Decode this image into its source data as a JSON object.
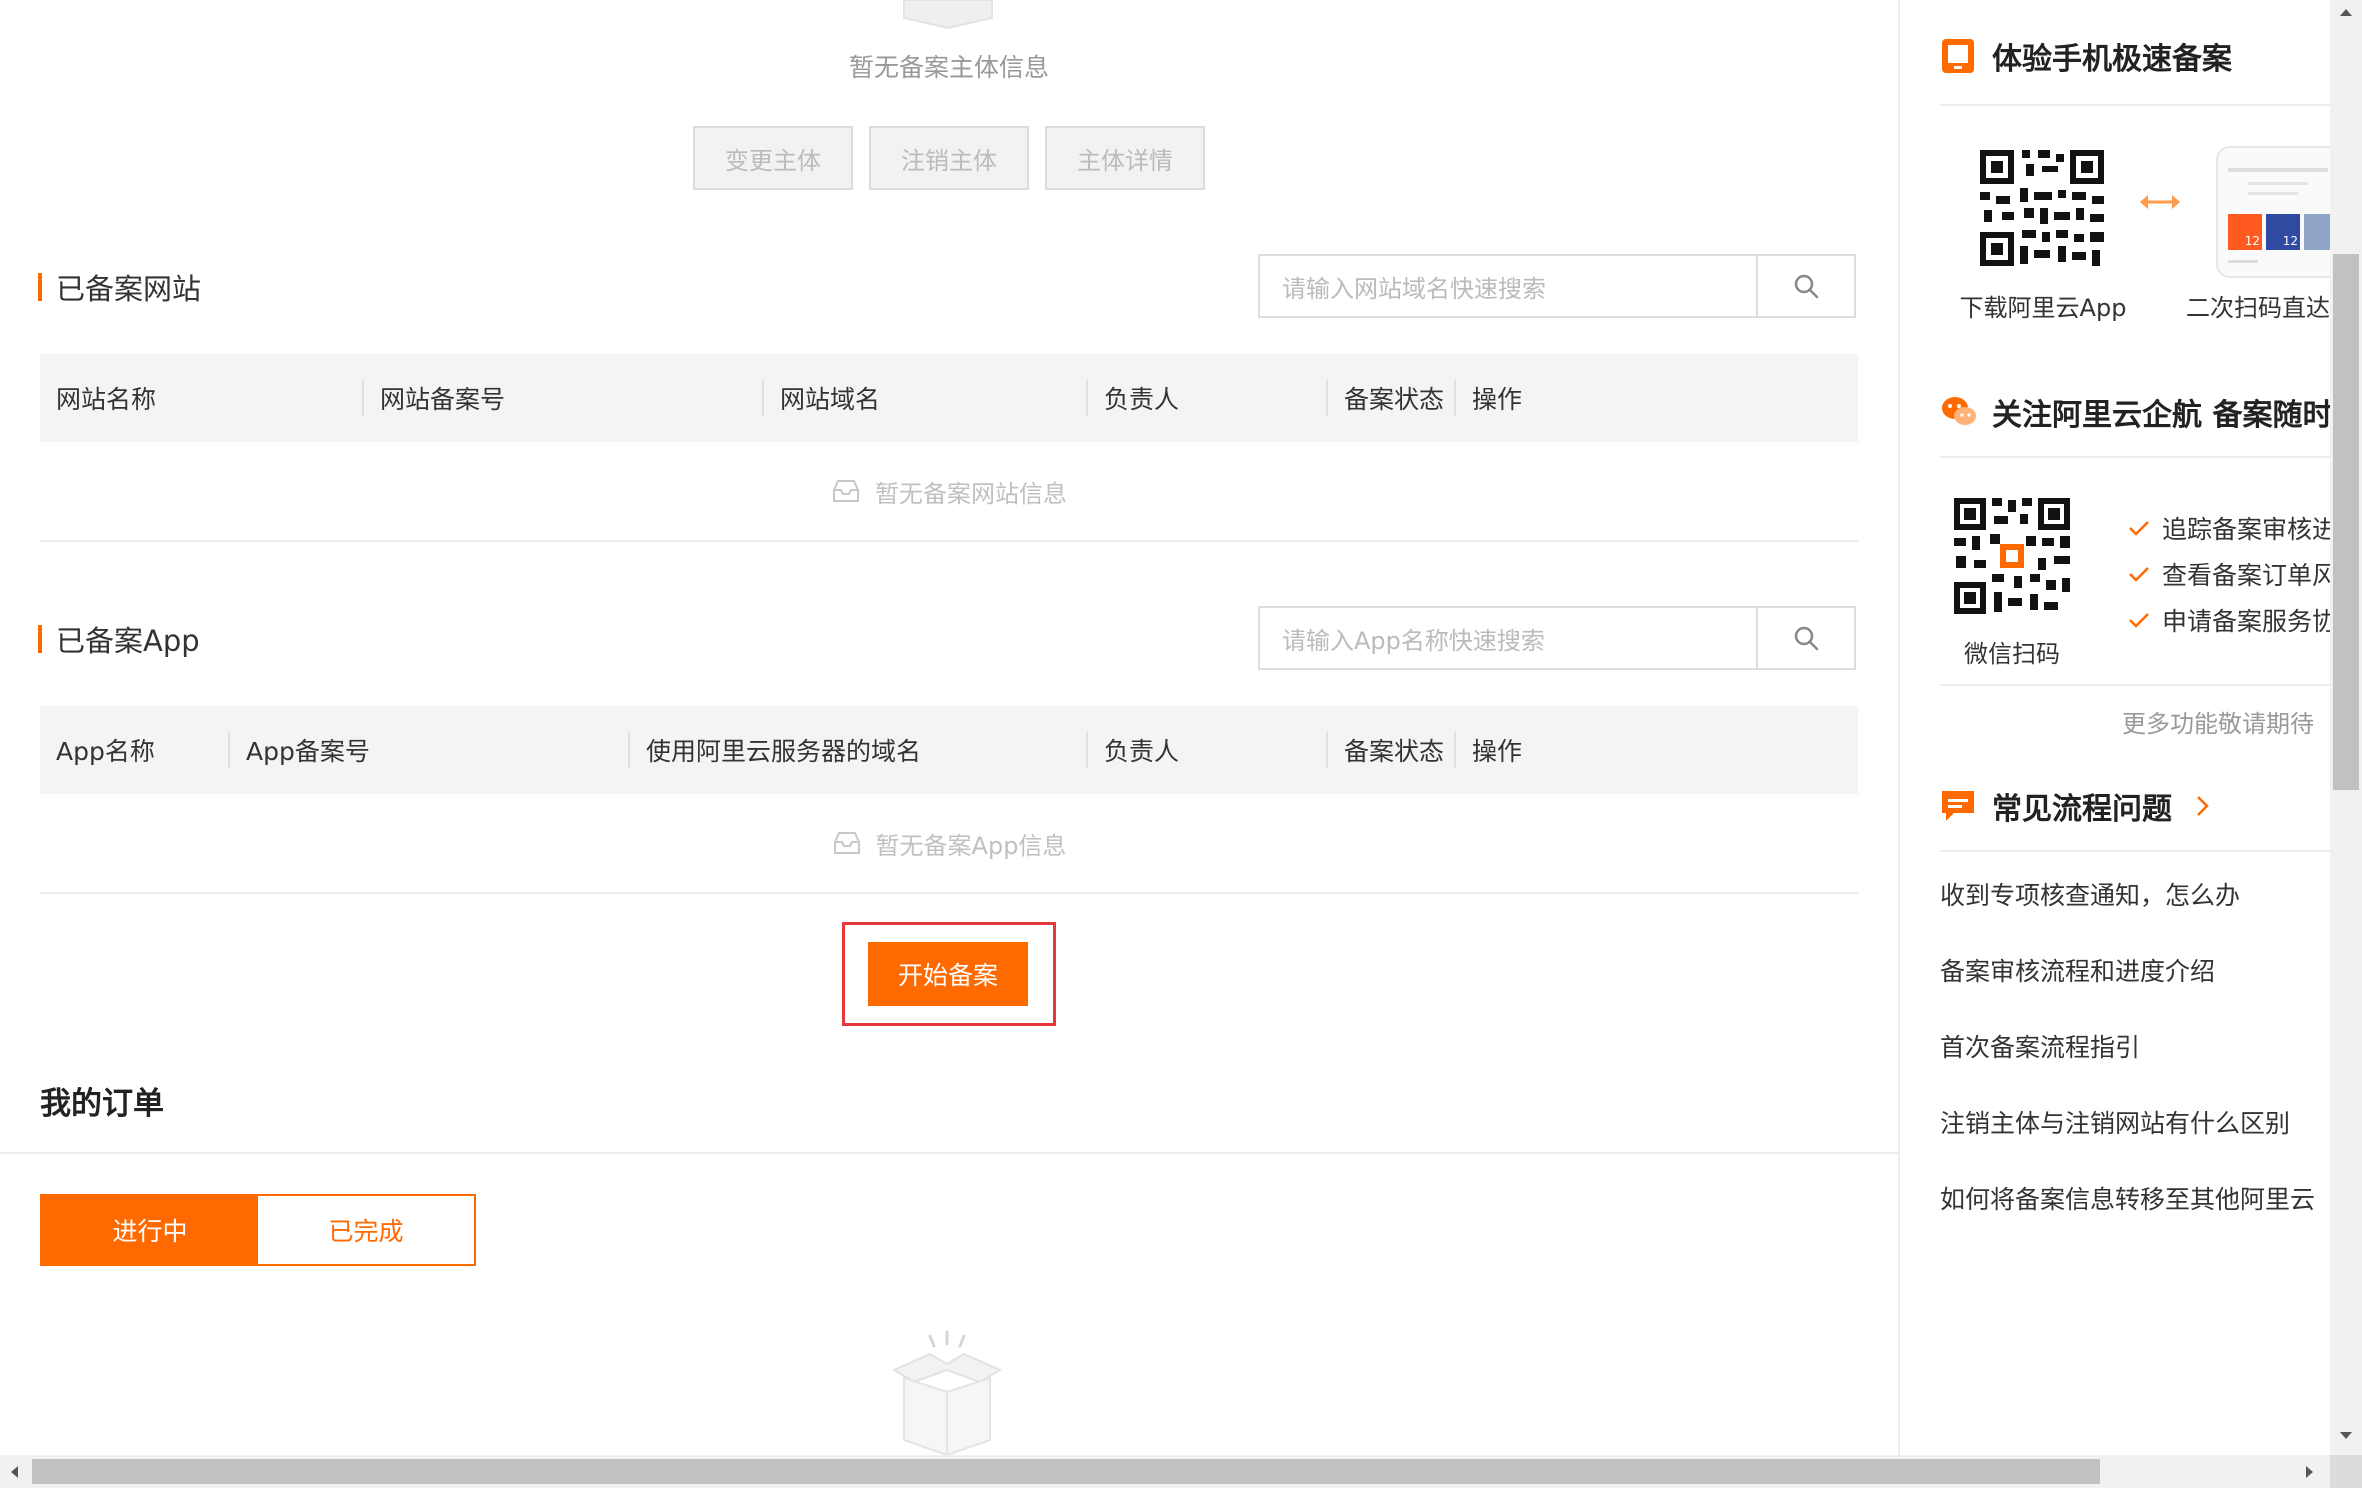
{
  "subject": {
    "empty_text": "暂无备案主体信息",
    "buttons": [
      "变更主体",
      "注销主体",
      "主体详情"
    ]
  },
  "websites": {
    "title": "已备案网站",
    "search_placeholder": "请输入网站域名快速搜索",
    "columns": [
      "网站名称",
      "网站备案号",
      "网站域名",
      "负责人",
      "备案状态",
      "操作"
    ],
    "empty_text": "暂无备案网站信息"
  },
  "apps": {
    "title": "已备案App",
    "search_placeholder": "请输入App名称快速搜索",
    "columns": [
      "App名称",
      "App备案号",
      "使用阿里云服务器的域名",
      "负责人",
      "备案状态",
      "操作"
    ],
    "empty_text": "暂无备案App信息"
  },
  "start_button": "开始备案",
  "orders": {
    "title": "我的订单",
    "tabs": [
      "进行中",
      "已完成"
    ],
    "active_tab": "进行中"
  },
  "side": {
    "mobile": {
      "title": "体验手机极速备案",
      "qr_caption": "下载阿里云App",
      "phone_caption": "二次扫码直达",
      "phone_badges": [
        "12",
        "12"
      ]
    },
    "wechat": {
      "title": "关注阿里云企航 备案随时",
      "qr_caption": "微信扫码",
      "features": [
        "追踪备案审核进",
        "查看备案订单风",
        "申请备案服务协"
      ],
      "more": "更多功能敬请期待"
    },
    "faq": {
      "title": "常见流程问题",
      "items": [
        "收到专项核查通知，怎么办",
        "备案审核流程和进度介绍",
        "首次备案流程指引",
        "注销主体与注销网站有什么区别",
        "如何将备案信息转移至其他阿里云"
      ]
    }
  },
  "colors": {
    "accent": "#ff6a00",
    "highlight_box": "#e5383b",
    "border": "#dcdcdc",
    "table_header": "#f4f4f4"
  }
}
